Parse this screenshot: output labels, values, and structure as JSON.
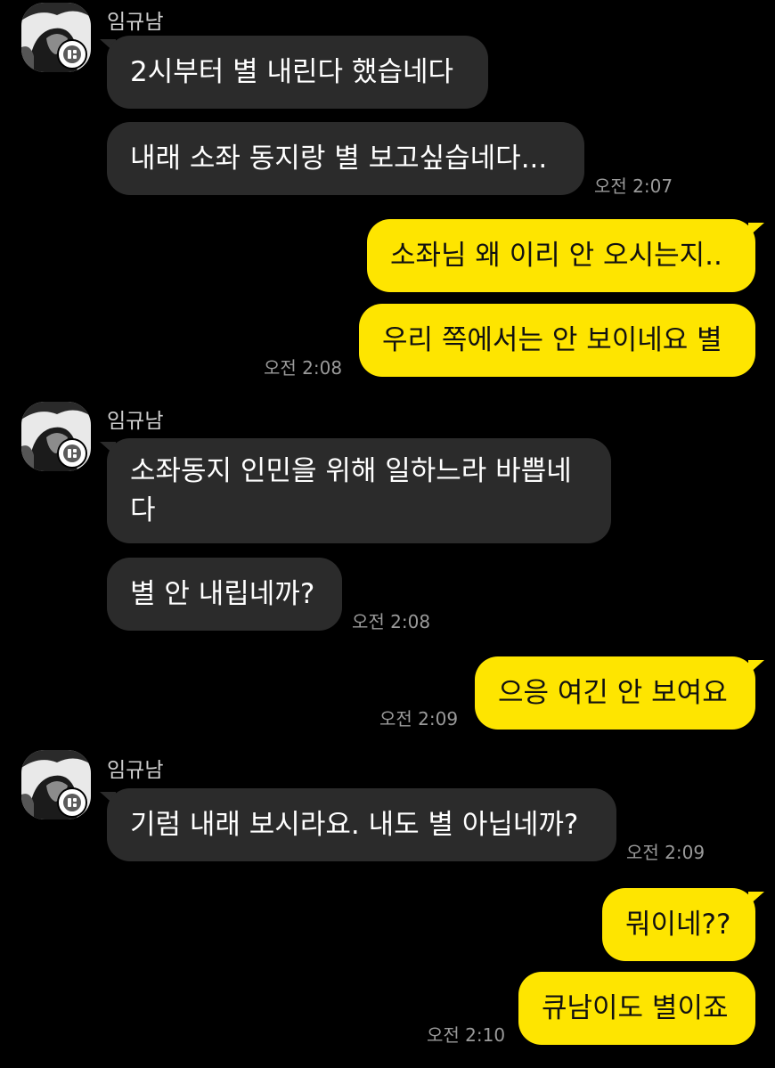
{
  "colors": {
    "background": "#000000",
    "incoming_bubble": "#2b2b2b",
    "outgoing_bubble": "#fee500",
    "timestamp": "#9a9a9a"
  },
  "groups": [
    {
      "sender": "임규남",
      "messages": [
        "2시부터 별 내린다 했습네다",
        "내래 소좌 동지랑 별 보고싶습네다..."
      ],
      "time": "오전 2:07"
    },
    {
      "messages": [
        "소좌님 왜 이리 안 오시는지..",
        "우리 쪽에서는 안 보이네요 별"
      ],
      "time": "오전 2:08"
    },
    {
      "sender": "임규남",
      "messages": [
        "소좌동지 인민을 위해 일하느라 바쁩네다",
        "별 안 내립네까?"
      ],
      "time": "오전 2:08"
    },
    {
      "messages": [
        "으응 여긴 안 보여요"
      ],
      "time": "오전 2:09"
    },
    {
      "sender": "임규남",
      "messages": [
        "기럼 내래 보시라요. 내도 별 아닙네까?"
      ],
      "time": "오전 2:09"
    },
    {
      "messages": [
        "뭐이네??",
        "큐남이도 별이죠"
      ],
      "time": "오전 2:10"
    }
  ]
}
